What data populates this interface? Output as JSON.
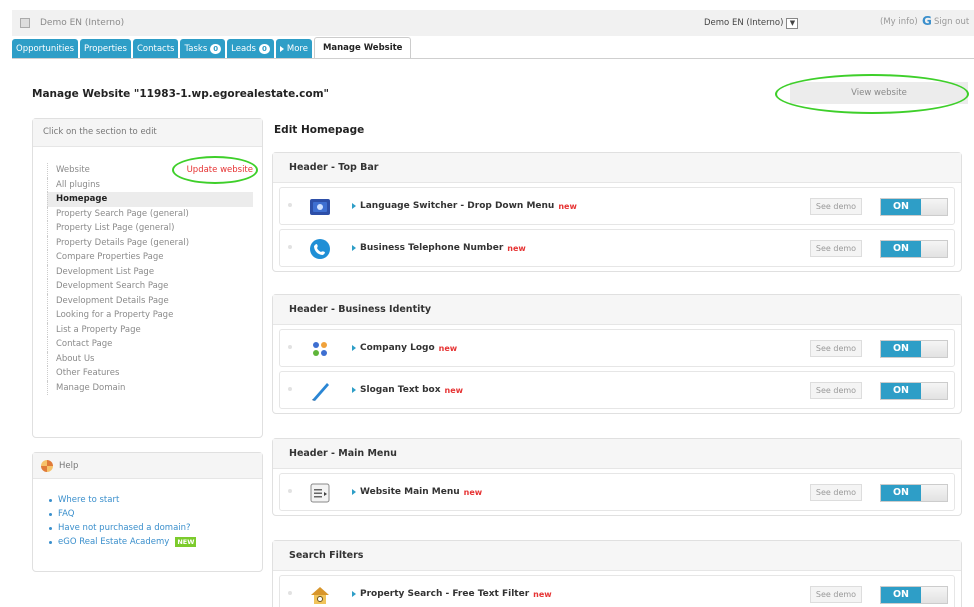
{
  "header": {
    "app_title": "Demo EN (Interno)",
    "account": "Demo EN (Interno)",
    "my_info": "(My info)",
    "sign_out": "Sign out"
  },
  "tabs": [
    {
      "label": "Opportunities"
    },
    {
      "label": "Properties"
    },
    {
      "label": "Contacts"
    },
    {
      "label": "Tasks",
      "badge": "0"
    },
    {
      "label": "Leads",
      "badge": "0"
    },
    {
      "label": "More"
    },
    {
      "label": "Manage Website",
      "active": true
    }
  ],
  "page": {
    "title": "Manage Website \"11983-1.wp.egorealestate.com\"",
    "view_website": "View website",
    "edit_title": "Edit Homepage"
  },
  "sidebar": {
    "heading": "Click on the section to edit",
    "update_link": "Update website",
    "items": [
      {
        "label": "Website"
      },
      {
        "label": "All plugins"
      },
      {
        "label": "Homepage",
        "selected": true
      },
      {
        "label": "Property Search Page (general)"
      },
      {
        "label": "Property List Page (general)"
      },
      {
        "label": "Property Details Page (general)"
      },
      {
        "label": "Compare Properties Page"
      },
      {
        "label": "Development List Page"
      },
      {
        "label": "Development Search Page"
      },
      {
        "label": "Development Details Page"
      },
      {
        "label": "Looking for a Property Page"
      },
      {
        "label": "List a Property Page"
      },
      {
        "label": "Contact Page"
      },
      {
        "label": "About Us"
      },
      {
        "label": "Other Features"
      },
      {
        "label": "Manage Domain"
      }
    ]
  },
  "help": {
    "heading": "Help",
    "items": [
      {
        "label": "Where to start"
      },
      {
        "label": "FAQ"
      },
      {
        "label": "Have not purchased a domain?"
      },
      {
        "label": "eGO Real Estate Academy",
        "badge": "NEW"
      }
    ]
  },
  "sections": [
    {
      "title": "Header - Top Bar",
      "plugins": [
        {
          "name": "Language Switcher - Drop Down Menu",
          "new": "new",
          "icon": "language-icon",
          "demo": "See demo",
          "toggle": "ON"
        },
        {
          "name": "Business Telephone Number",
          "new": "new",
          "icon": "phone-icon",
          "demo": "See demo",
          "toggle": "ON"
        }
      ]
    },
    {
      "title": "Header - Business Identity",
      "plugins": [
        {
          "name": "Company Logo",
          "new": "new",
          "icon": "logo-icon",
          "demo": "See demo",
          "toggle": "ON"
        },
        {
          "name": "Slogan Text box",
          "new": "new",
          "icon": "pen-icon",
          "demo": "See demo",
          "toggle": "ON"
        }
      ]
    },
    {
      "title": "Header - Main Menu",
      "plugins": [
        {
          "name": "Website Main Menu",
          "new": "new",
          "icon": "menu-icon",
          "demo": "See demo",
          "toggle": "ON"
        }
      ]
    },
    {
      "title": "Search Filters",
      "plugins": [
        {
          "name": "Property Search - Free Text Filter",
          "new": "new",
          "icon": "house-search-icon",
          "demo": "See demo",
          "toggle": "ON"
        }
      ]
    }
  ],
  "colors": {
    "accent": "#2e9ec7",
    "highlight_circle": "#3ecf2a",
    "new_red": "#e63333"
  }
}
